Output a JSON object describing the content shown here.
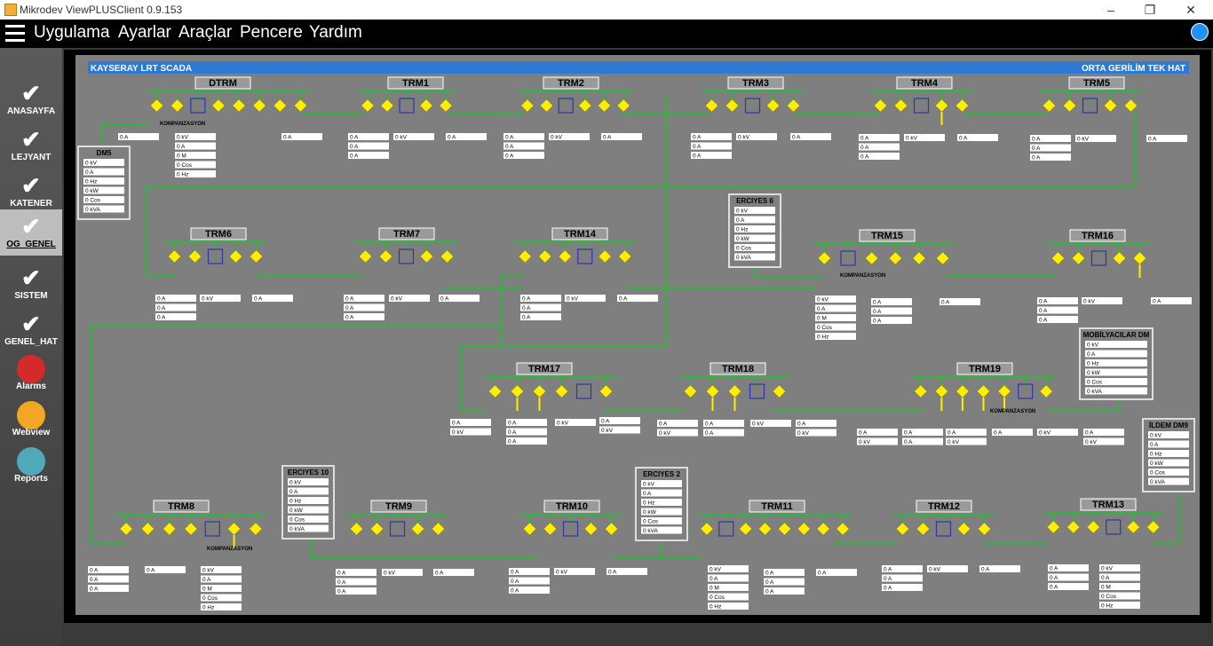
{
  "window": {
    "title": "Mikrodev ViewPLUSClient 0.9.153",
    "min": "–",
    "max": "❐",
    "close": "✕"
  },
  "menu": [
    "Uygulama",
    "Ayarlar",
    "Araçlar",
    "Pencere",
    "Yardım"
  ],
  "sidebar": [
    {
      "label": "ANASAYFA",
      "icon": "check-icon"
    },
    {
      "label": "LEJYANT",
      "icon": "check-icon"
    },
    {
      "label": "KATENER",
      "icon": "check-icon"
    },
    {
      "label": "OG_GENEL",
      "icon": "check-icon",
      "active": true
    },
    {
      "label": "SISTEM",
      "icon": "check-icon"
    },
    {
      "label": "GENEL_HAT",
      "icon": "check-icon"
    },
    {
      "label": "Alarms",
      "icon": "alarm-siren-icon"
    },
    {
      "label": "Webview",
      "icon": "cloud-icon"
    },
    {
      "label": "Reports",
      "icon": "report-chart-icon"
    }
  ],
  "header": {
    "left": "KAYSERAY LRT SCADA",
    "right": "ORTA GERİLİM TEK HAT"
  },
  "komp": "KOMPANZASYON",
  "colors": {
    "busbar": "#2db83d",
    "breaker_closed": "#ffee00",
    "transformer": "#3333aa",
    "header_blue": "#2d79d4"
  },
  "stations": [
    {
      "name": "DTRM"
    },
    {
      "name": "TRM1"
    },
    {
      "name": "TRM2"
    },
    {
      "name": "TRM3"
    },
    {
      "name": "TRM4"
    },
    {
      "name": "TRM5"
    },
    {
      "name": "TRM6"
    },
    {
      "name": "TRM7"
    },
    {
      "name": "TRM14"
    },
    {
      "name": "TRM15"
    },
    {
      "name": "TRM16"
    },
    {
      "name": "TRM17"
    },
    {
      "name": "TRM18"
    },
    {
      "name": "TRM19"
    },
    {
      "name": "TRM8"
    },
    {
      "name": "TRM9"
    },
    {
      "name": "TRM10"
    },
    {
      "name": "TRM11"
    },
    {
      "name": "TRM12"
    },
    {
      "name": "TRM13"
    }
  ],
  "dm_boxes": [
    {
      "title": "DM5",
      "values": [
        "0 kV",
        "0 A",
        "0 Hz",
        "0 kW",
        "0 Cos",
        "0 kVA"
      ]
    },
    {
      "title": "ERCIYES 6",
      "values": [
        "0 kV",
        "0 A",
        "0 Hz",
        "0 kW",
        "0 Cos",
        "0 kVA"
      ]
    },
    {
      "title": "MOBİLYACILAR DM",
      "values": [
        "0 kV",
        "0 A",
        "0 Hz",
        "0 kW",
        "0 Cos",
        "0 kVA"
      ]
    },
    {
      "title": "ERCIYES 10",
      "values": [
        "0 kV",
        "0 A",
        "0 Hz",
        "0 kW",
        "0 Cos",
        "0 kVA"
      ]
    },
    {
      "title": "ERCIYES 2",
      "values": [
        "0 kV",
        "0 A",
        "0 Hz",
        "0 kW",
        "0 Cos",
        "0 kVA"
      ]
    },
    {
      "title": "İLDEM DM9",
      "values": [
        "0 kV",
        "0 A",
        "0 Hz",
        "0 kW",
        "0 Cos",
        "0 kVA"
      ]
    }
  ],
  "readings": [
    {
      "id": "dtrm_l",
      "values": [
        "0 A"
      ]
    },
    {
      "id": "dtrm_c",
      "values": [
        "0 kV",
        "0 A",
        "0 M",
        "0 Cos",
        "0 Hz"
      ]
    },
    {
      "id": "dtrm_r",
      "values": [
        "0 A"
      ]
    },
    {
      "id": "trm1_l",
      "values": [
        "0 A",
        "0 A",
        "0 A"
      ]
    },
    {
      "id": "trm1_m",
      "values": [
        "0 kV"
      ]
    },
    {
      "id": "trm1_r",
      "values": [
        "0 A"
      ]
    },
    {
      "id": "trm2_l",
      "values": [
        "0 A",
        "0 A",
        "0 A"
      ]
    },
    {
      "id": "trm2_m",
      "values": [
        "0 kV"
      ]
    },
    {
      "id": "trm2_r",
      "values": [
        "0 A"
      ]
    },
    {
      "id": "trm3_l",
      "values": [
        "0 A",
        "0 A",
        "0 A"
      ]
    },
    {
      "id": "trm3_m",
      "values": [
        "0 kV"
      ]
    },
    {
      "id": "trm3_r",
      "values": [
        "0 A"
      ]
    },
    {
      "id": "trm4_l",
      "values": [
        "0 A",
        "0 A",
        "0 A"
      ]
    },
    {
      "id": "trm4_m",
      "values": [
        "0 kV"
      ]
    },
    {
      "id": "trm4_r",
      "values": [
        "0 A"
      ]
    },
    {
      "id": "trm5_l",
      "values": [
        "0 A",
        "0 A",
        "0 A"
      ]
    },
    {
      "id": "trm5_m",
      "values": [
        "0 kV"
      ]
    },
    {
      "id": "trm5_r",
      "values": [
        "0 A"
      ]
    },
    {
      "id": "trm6_l",
      "values": [
        "0 A",
        "0 A",
        "0 A"
      ]
    },
    {
      "id": "trm6_m",
      "values": [
        "0 kV"
      ]
    },
    {
      "id": "trm6_r",
      "values": [
        "0 A"
      ]
    },
    {
      "id": "trm7_l",
      "values": [
        "0 A",
        "0 A",
        "0 A"
      ]
    },
    {
      "id": "trm7_m",
      "values": [
        "0 kV"
      ]
    },
    {
      "id": "trm7_r",
      "values": [
        "0 A"
      ]
    },
    {
      "id": "trm14_l",
      "values": [
        "0 A",
        "0 A",
        "0 A"
      ]
    },
    {
      "id": "trm14_m",
      "values": [
        "0 kV"
      ]
    },
    {
      "id": "trm14_r",
      "values": [
        "0 A"
      ]
    },
    {
      "id": "trm15_c",
      "values": [
        "0 kV",
        "0 A",
        "0 M",
        "0 Cos",
        "0 Hz"
      ]
    },
    {
      "id": "trm15_l",
      "values": [
        "0 A",
        "0 A",
        "0 A"
      ]
    },
    {
      "id": "trm15_r",
      "values": [
        "0 A"
      ]
    },
    {
      "id": "trm16_l",
      "values": [
        "0 A",
        "0 A",
        "0 A"
      ]
    },
    {
      "id": "trm16_m",
      "values": [
        "0 kV"
      ]
    },
    {
      "id": "trm16_r",
      "values": [
        "0 A"
      ]
    },
    {
      "id": "trm17_l",
      "values": [
        "0 A",
        "0 kV"
      ]
    },
    {
      "id": "trm17_m",
      "values": [
        "0 A",
        "0 A",
        "0 A"
      ]
    },
    {
      "id": "trm17_n",
      "values": [
        "0 kV"
      ]
    },
    {
      "id": "trm17_r",
      "values": [
        "0 A",
        "0 kV"
      ]
    },
    {
      "id": "trm18_l",
      "values": [
        "0 A",
        "0 kV"
      ]
    },
    {
      "id": "trm18_m",
      "values": [
        "0 A",
        "0 A"
      ]
    },
    {
      "id": "trm18_n",
      "values": [
        "0 kV"
      ]
    },
    {
      "id": "trm18_r",
      "values": [
        "0 A",
        "0 kV"
      ]
    },
    {
      "id": "trm19_a",
      "values": [
        "0 A",
        "0 kV"
      ]
    },
    {
      "id": "trm19_b",
      "values": [
        "0 A",
        "0 A"
      ]
    },
    {
      "id": "trm19_c",
      "values": [
        "0 A",
        "0 kV"
      ]
    },
    {
      "id": "trm19_d",
      "values": [
        "0 A"
      ]
    },
    {
      "id": "trm19_e",
      "values": [
        "0 kV"
      ]
    },
    {
      "id": "trm19_f",
      "values": [
        "0 A",
        "0 kV"
      ]
    },
    {
      "id": "trm8_l",
      "values": [
        "0 A",
        "0 A",
        "0 A"
      ]
    },
    {
      "id": "trm8_m",
      "values": [
        "0 A"
      ]
    },
    {
      "id": "trm8_c",
      "values": [
        "0 kV",
        "0 A",
        "0 M",
        "0 Cos",
        "0 Hz"
      ]
    },
    {
      "id": "trm9_l",
      "values": [
        "0 A",
        "0 A",
        "0 A"
      ]
    },
    {
      "id": "trm9_m",
      "values": [
        "0 kV"
      ]
    },
    {
      "id": "trm9_r",
      "values": [
        "0 A"
      ]
    },
    {
      "id": "trm10_l",
      "values": [
        "0 A",
        "0 A",
        "0 A"
      ]
    },
    {
      "id": "trm10_m",
      "values": [
        "0 kV"
      ]
    },
    {
      "id": "trm10_r",
      "values": [
        "0 A"
      ]
    },
    {
      "id": "trm11_c",
      "values": [
        "0 kV",
        "0 A",
        "0 M",
        "0 Cos",
        "0 Hz"
      ]
    },
    {
      "id": "trm11_l",
      "values": [
        "0 A",
        "0 A",
        "0 A"
      ]
    },
    {
      "id": "trm11_r",
      "values": [
        "0 A"
      ]
    },
    {
      "id": "trm12_l",
      "values": [
        "0 A",
        "0 A",
        "0 A"
      ]
    },
    {
      "id": "trm12_m",
      "values": [
        "0 kV"
      ]
    },
    {
      "id": "trm12_r",
      "values": [
        "0 A"
      ]
    },
    {
      "id": "trm13_l",
      "values": [
        "0 A",
        "0 A",
        "0 A"
      ]
    },
    {
      "id": "trm13_c",
      "values": [
        "0 kV",
        "0 A",
        "0 M",
        "0 Cos",
        "0 Hz"
      ]
    }
  ]
}
